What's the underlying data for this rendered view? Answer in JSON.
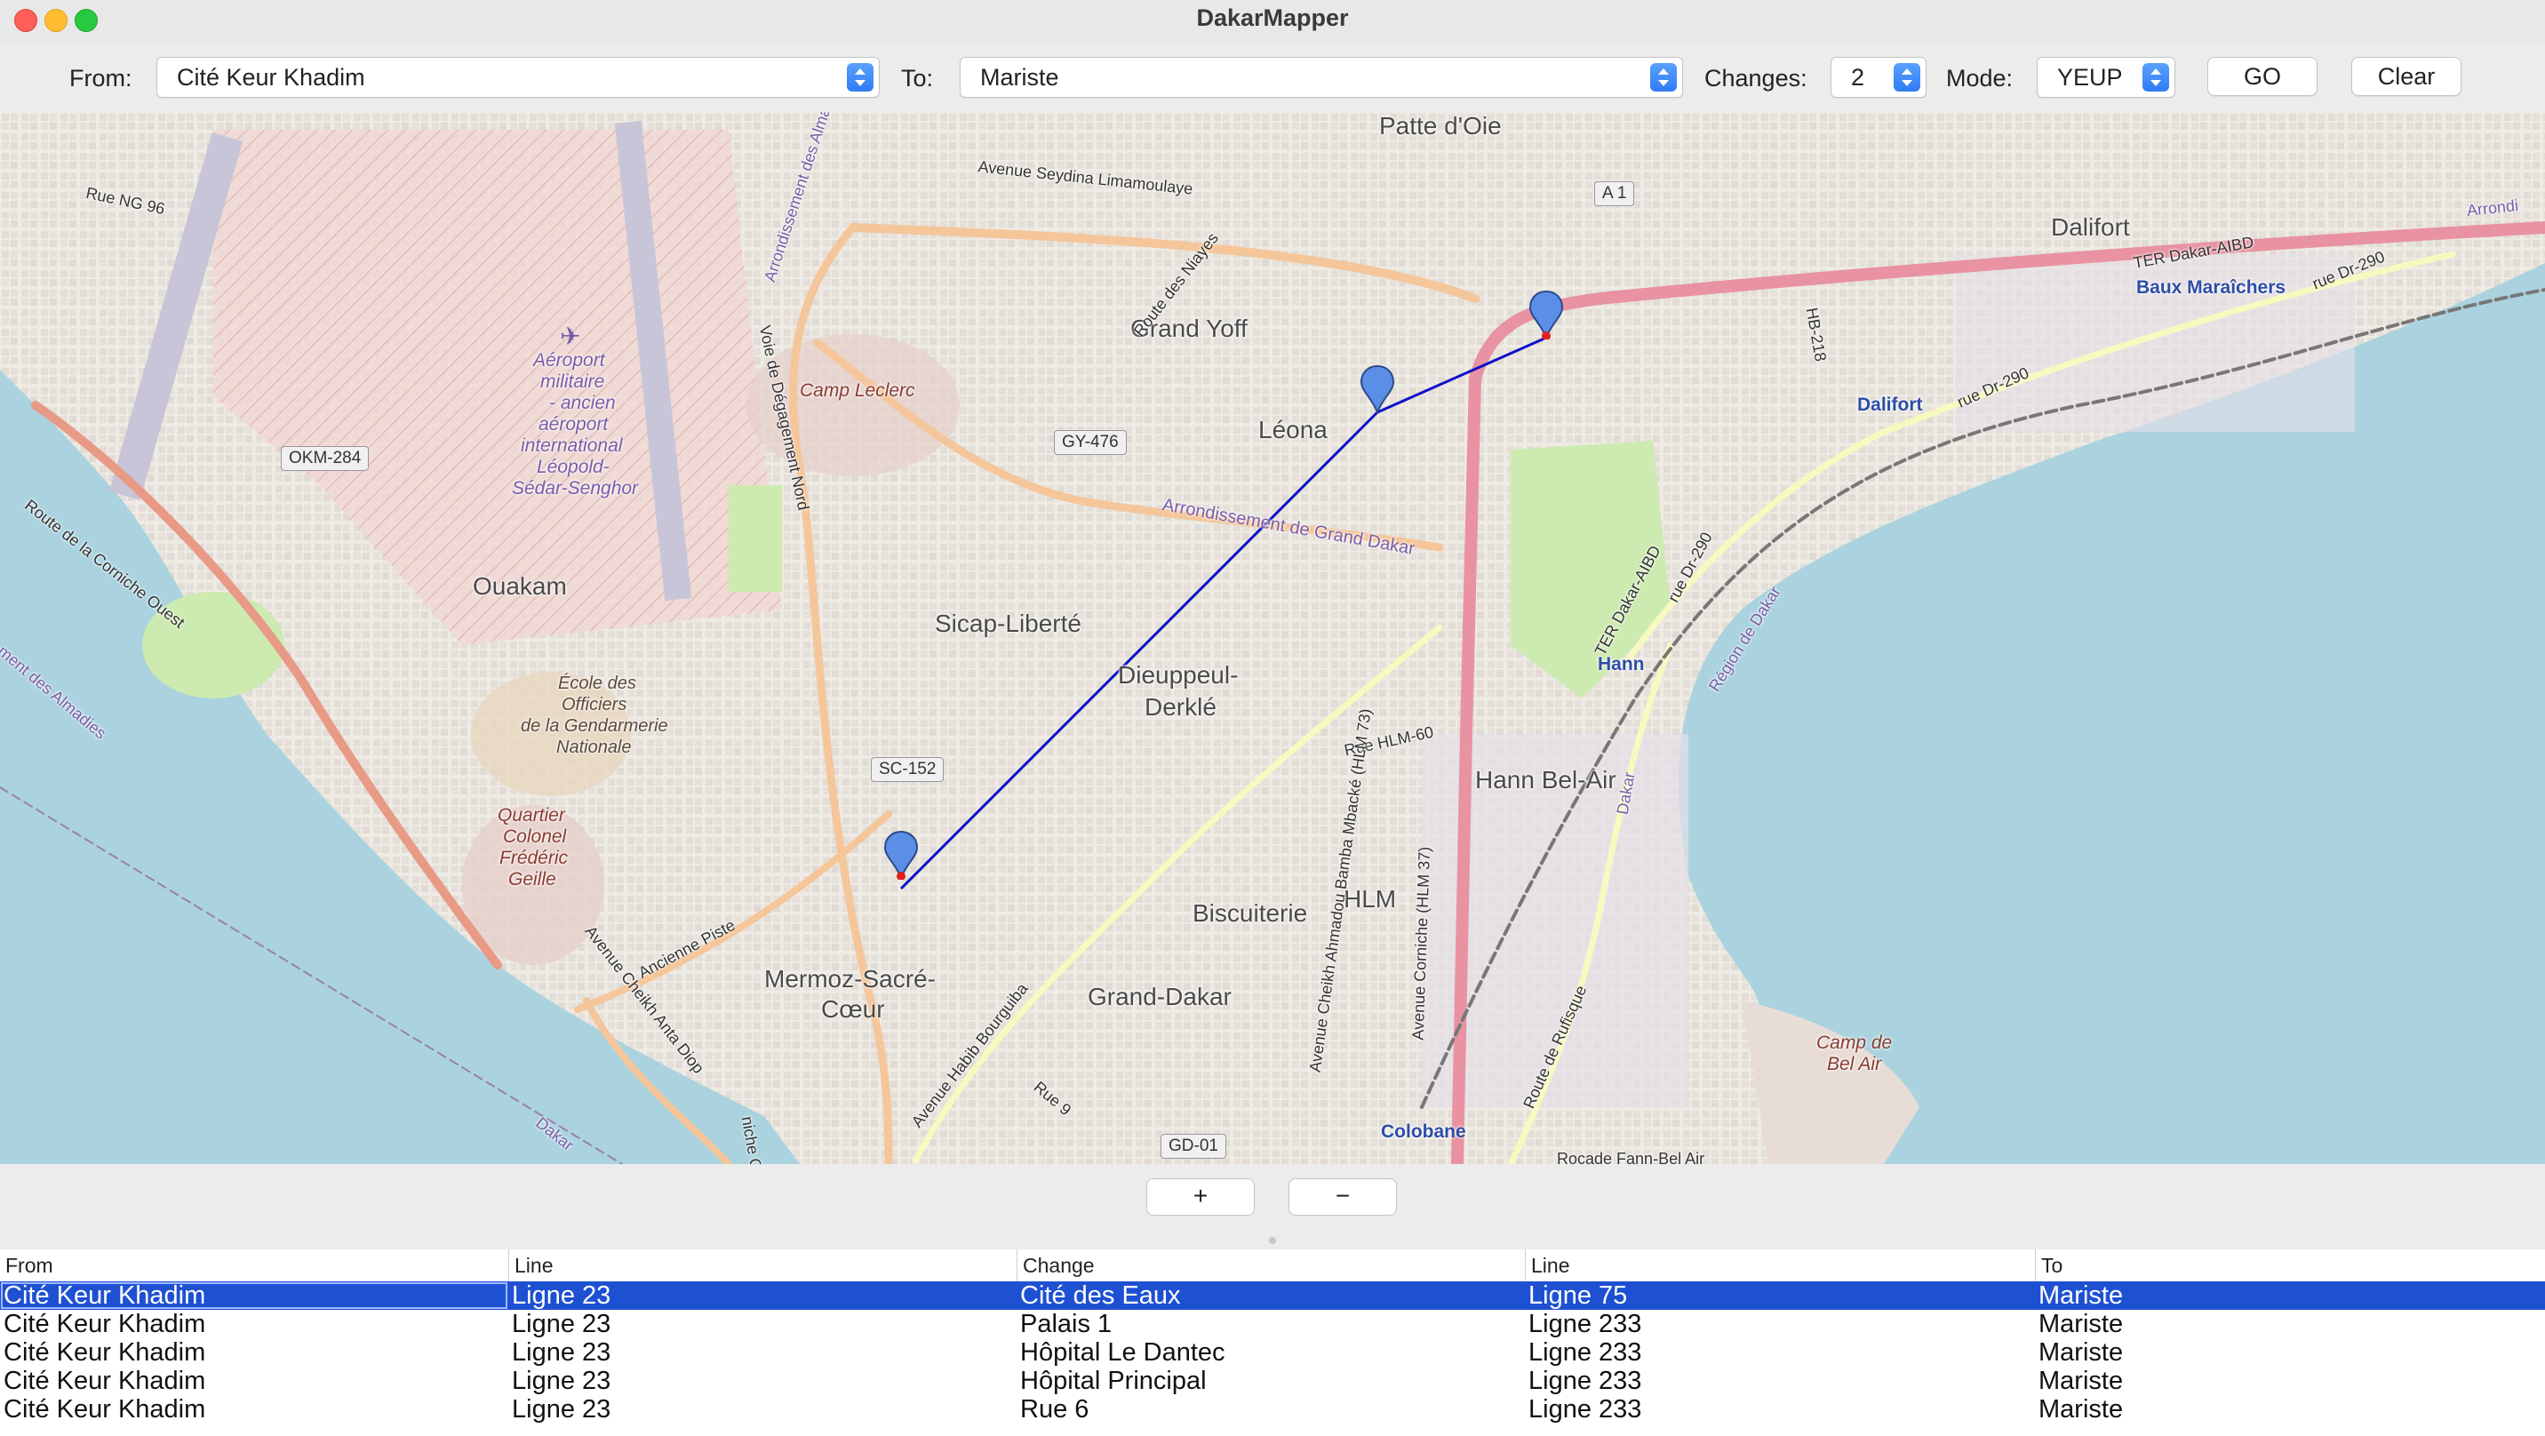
{
  "window": {
    "title": "DakarMapper"
  },
  "toolbar": {
    "from_label": "From:",
    "from_value": "Cité Keur Khadim",
    "to_label": "To:",
    "to_value": "Mariste",
    "changes_label": "Changes:",
    "changes_value": "2",
    "mode_label": "Mode:",
    "mode_value": "YEUP",
    "go_label": "GO",
    "clear_label": "Clear"
  },
  "map": {
    "places": {
      "patte_doie": "Patte d'Oie",
      "grand_yoff": "Grand Yoff",
      "leona": "Léona",
      "dalifort": "Dalifort",
      "ouakam": "Ouakam",
      "sicap_liberte": "Sicap-Liberté",
      "dieuppeul_derkle_1": "Dieuppeul-",
      "dieuppeul_derkle_2": "Derklé",
      "hann_bel_air": "Hann Bel-Air",
      "hlm": "HLM",
      "biscuiterie": "Biscuiterie",
      "grand_dakar": "Grand-Dakar",
      "mermoz_1": "Mermoz-Sacré-",
      "mermoz_2": "Cœur"
    },
    "pois": {
      "aeroport": [
        "Aéroport",
        "militaire",
        "- ancien",
        "aéroport",
        "international",
        "Léopold-",
        "Sédar-Senghor"
      ],
      "camp_leclerc": "Camp Leclerc",
      "ecole": [
        "École des",
        "Officiers",
        "de la Gendarmerie",
        "Nationale"
      ],
      "quartier": [
        "Quartier",
        "Colonel",
        "Frédéric",
        "Geille"
      ],
      "camp_bel_air": [
        "Camp de",
        "Bel Air"
      ]
    },
    "stations": {
      "dalifort": "Dalifort",
      "baux": "Baux Maraîchers",
      "hann": "Hann",
      "colobane": "Colobane"
    },
    "shields": {
      "okm284": "OKM-284",
      "gy476": "GY-476",
      "sc152": "SC-152",
      "a1": "A 1",
      "gd01": "GD-01"
    },
    "roads": {
      "ng96": "Rue NG 96",
      "corniche_ouest": "Route de la Corniche Ouest",
      "seydina": "Avenue Seydina Limamoulaye",
      "niayes": "Route des Niayes",
      "degagement": "Voie de Dégagement Nord",
      "arr_almadies": "Arrondissement des Almadies",
      "arr_grand_dakar": "Arrondissement de Grand Dakar",
      "hb218": "HB-218",
      "ter_aibd": "TER Dakar-AIBD",
      "ter_aibd2": "TER Dakar-AIBD",
      "rue_dr290": "rue Dr-290",
      "rue_dr290b": "rue Dr-290",
      "rue_dr290c": "rue Dr-290",
      "region_dakar": "Région de Dakar",
      "hlm60": "Rue HLM-60",
      "cheikh_ahmadou": "Avenue Cheikh Ahmadou Bamba Mbacké (HLM 73)",
      "ave_corniche": "Avenue Corniche (HLM 37)",
      "route_rufisque": "Route de Rufisque",
      "ancienne_piste": "Ancienne Piste",
      "cheikh_anta": "Avenue Cheikh Anta Diop",
      "habib": "Avenue Habib Bourguiba",
      "rue9": "Rue 9",
      "rocade": "Rocade Fann-Bel Air",
      "dakar": "Dakar",
      "dakar2": "Dakar",
      "arrondi": "Arrondi",
      "almadies_left": "ment des Almadies",
      "corniche_bottom": "niche Ouest"
    },
    "markers": [
      "Cité Keur Khadim",
      "transfer",
      "Mariste"
    ]
  },
  "zoom": {
    "in_label": "+",
    "out_label": "−"
  },
  "results": {
    "columns": [
      "From",
      "Line",
      "Change",
      "Line",
      "To"
    ],
    "rows": [
      [
        "Cité Keur Khadim",
        "Ligne 23",
        "Cité des Eaux",
        "Ligne 75",
        "Mariste"
      ],
      [
        "Cité Keur Khadim",
        "Ligne 23",
        "Palais 1",
        "Ligne 233",
        "Mariste"
      ],
      [
        "Cité Keur Khadim",
        "Ligne 23",
        "Hôpital Le Dantec",
        "Ligne 233",
        "Mariste"
      ],
      [
        "Cité Keur Khadim",
        "Ligne 23",
        "Hôpital Principal",
        "Ligne 233",
        "Mariste"
      ],
      [
        "Cité Keur Khadim",
        "Ligne 23",
        "Rue 6",
        "Ligne 233",
        "Mariste"
      ]
    ],
    "selected_row": 0
  },
  "colors": {
    "selection": "#1e50d2",
    "route_line": "#1010c8",
    "marker_blue": "#5b8ee6",
    "marker_dot": "#e02020",
    "sea": "#aad3df",
    "land": "#f2efe9"
  }
}
